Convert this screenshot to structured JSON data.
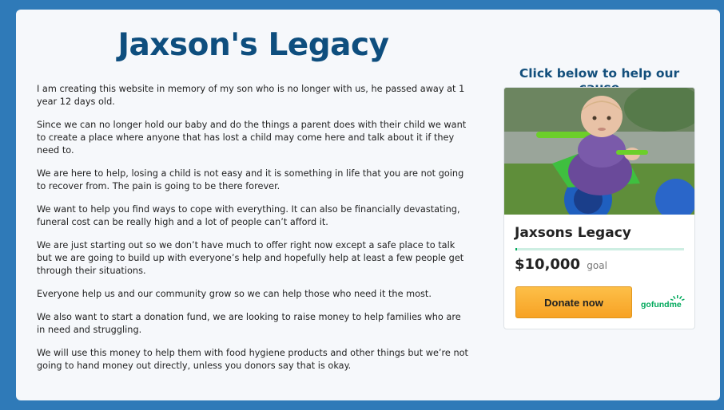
{
  "page": {
    "title": "Jaxson's Legacy",
    "paragraphs": [
      "I am creating this website in memory of my son who is no longer with us, he passed away at 1 year 12 days old.",
      "Since we can no longer hold our baby and do the things a parent does with their child we want to create a place where anyone that has lost a child may come here and talk about it if they need to.",
      "We are here to help, losing a child is not easy and it is something in life that you are not going to recover from. The pain is going to be there forever.",
      "We want to help you find ways to cope with everything. It can also be financially devastating, funeral cost can be really high and a lot of people can’t afford it.",
      "We are just starting out so we don’t have much to offer right now except a safe place to talk but we are going to build up with everyone’s help and hopefully help at least a few people get through their situations.",
      "Everyone help us and our community grow so we can help those who need it the most.",
      "We also want to start a donation fund, we are looking to raise money to help families who are in need and struggling.",
      "We will use this money to help them with food hygiene products and other things but we’re not going to hand money out directly, unless you donors say that is okay."
    ]
  },
  "sidebar": {
    "cta_heading": "Click below to help our cause",
    "widget": {
      "campaign_name": "Jaxsons Legacy",
      "goal_amount": "$10,000",
      "goal_word": "goal",
      "progress_fraction": 0.01,
      "donate_label": "Donate now",
      "logo_text": "gofundme",
      "photo_icon": "child-on-tricycle-photo"
    }
  },
  "colors": {
    "background": "#2f7ab8",
    "title": "#0e4e7e",
    "accent_green": "#02a95c",
    "button_orange": "#f7a224"
  }
}
